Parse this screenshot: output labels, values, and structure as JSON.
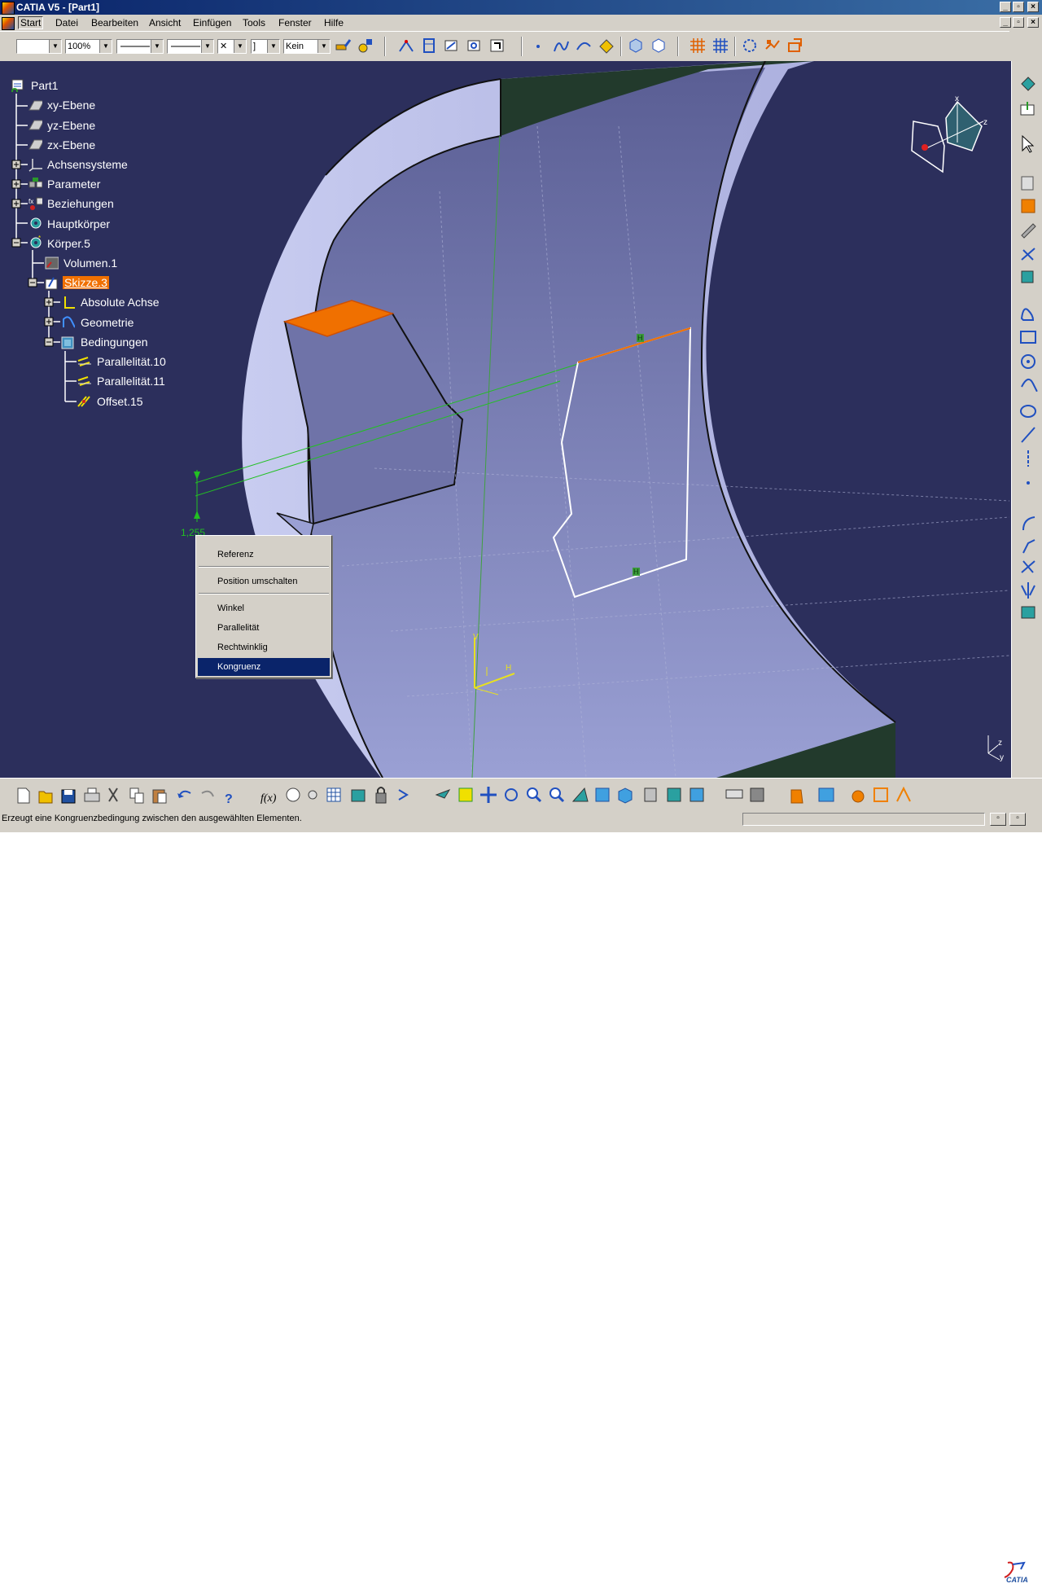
{
  "window": {
    "title": "CATIA V5 - [Part1]"
  },
  "menubar": {
    "items": [
      "Start",
      "Datei",
      "Bearbeiten",
      "Ansicht",
      "Einfügen",
      "Tools",
      "Fenster",
      "Hilfe"
    ]
  },
  "toolbar_top": {
    "zoom_value": "100%",
    "linetype_value": "Kein"
  },
  "tree": {
    "nodes": [
      {
        "label": "Part1"
      },
      {
        "label": "xy-Ebene"
      },
      {
        "label": "yz-Ebene"
      },
      {
        "label": "zx-Ebene"
      },
      {
        "label": "Achsensysteme"
      },
      {
        "label": "Parameter"
      },
      {
        "label": "Beziehungen"
      },
      {
        "label": "Hauptkörper"
      },
      {
        "label": "Körper.5"
      },
      {
        "label": "Volumen.1"
      },
      {
        "label": "Skizze.3"
      },
      {
        "label": "Absolute Achse"
      },
      {
        "label": "Geometrie"
      },
      {
        "label": "Bedingungen"
      },
      {
        "label": "Parallelität.10"
      },
      {
        "label": "Parallelität.11"
      },
      {
        "label": "Offset.15"
      }
    ]
  },
  "viewport": {
    "dimension_label": "1,255",
    "compass_x": "x",
    "compass_z": "z",
    "sketch_axis_v": "V",
    "sketch_axis_h": "H",
    "constraint_h1": "H",
    "constraint_h2": "H",
    "corner_axis_z": "z",
    "corner_axis_y": "y",
    "corner_axis_x": "x"
  },
  "context_menu": {
    "items": [
      "Referenz",
      "Position umschalten",
      "Winkel",
      "Parallelität",
      "Rechtwinklig",
      "Kongruenz"
    ],
    "highlighted": "Kongruenz"
  },
  "statusbar": {
    "message": "Erzeugt eine Kongruenzbedingung zwischen den ausgewählten Elementen."
  },
  "logo": {
    "text": "CATIA"
  },
  "colors": {
    "viewport_bg": "#2c2f5c",
    "part_face": "#8a8fc4",
    "highlight_orange": "#f07000",
    "selection_blue": "#0a246a",
    "constraint_green": "#22c022"
  }
}
